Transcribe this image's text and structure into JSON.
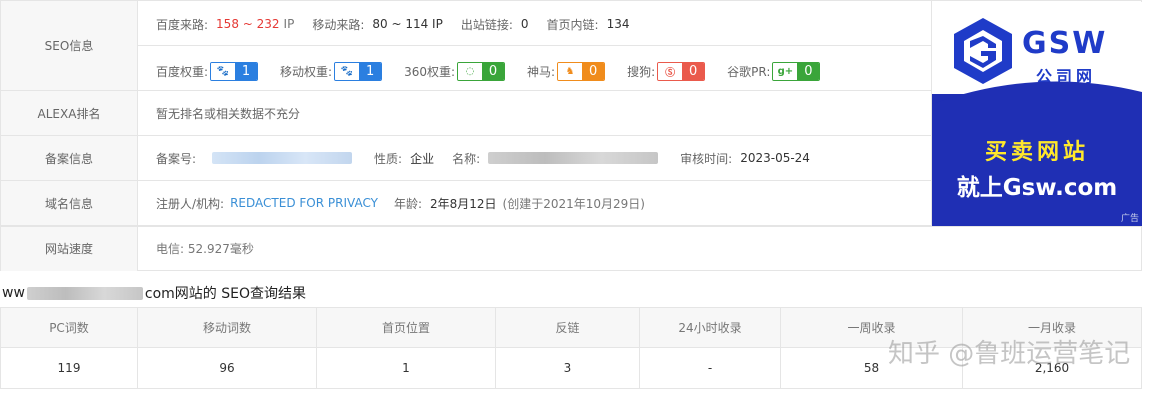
{
  "seo": {
    "label": "SEO信息",
    "line1": {
      "baidu_source_label": "百度来路:",
      "baidu_source_value": "158 ~ 232",
      "baidu_source_unit": "IP",
      "mobile_source_label": "移动来路:",
      "mobile_source_value": "80 ~ 114 IP",
      "outbound_label": "出站链接:",
      "outbound_value": "0",
      "homepage_links_label": "首页内链:",
      "homepage_links_value": "134"
    },
    "line2": {
      "baidu_weight_label": "百度权重:",
      "baidu_weight_value": "1",
      "mobile_weight_label": "移动权重:",
      "mobile_weight_value": "1",
      "w360_label": "360权重:",
      "w360_value": "0",
      "shenma_label": "神马:",
      "shenma_value": "0",
      "sogou_label": "搜狗:",
      "sogou_value": "0",
      "google_label": "谷歌PR:",
      "google_value": "0"
    }
  },
  "alexa": {
    "label": "ALEXA排名",
    "value": "暂无排名或相关数据不充分"
  },
  "icp": {
    "label": "备案信息",
    "number_label": "备案号:",
    "nature_label": "性质:",
    "nature_value": "企业",
    "name_label": "名称:",
    "audit_label": "审核时间:",
    "audit_value": "2023-05-24"
  },
  "domain": {
    "label": "域名信息",
    "registrant_label": "注册人/机构:",
    "registrant_value": "REDACTED FOR PRIVACY",
    "age_label": "年龄:",
    "age_value": "2年8月12日",
    "created_note": "(创建于2021年10月29日)"
  },
  "speed": {
    "label": "网站速度",
    "value": "电信: 52.927毫秒"
  },
  "ad": {
    "brand": "GSW",
    "sub": "公司网",
    "line1": "买卖网站",
    "line2": "就上Gsw.com",
    "tag": "广告"
  },
  "result": {
    "prefix": "ww",
    "suffix": "com网站的 SEO查询结果"
  },
  "stats": {
    "headers": [
      "PC词数",
      "移动词数",
      "首页位置",
      "反链",
      "24小时收录",
      "一周收录",
      "一月收录"
    ],
    "values": [
      "119",
      "96",
      "1",
      "3",
      "-",
      "58",
      "2,160"
    ]
  },
  "watermark": "知乎 @鲁班运营笔记",
  "colors": {
    "red": "#e53935",
    "link": "#3a8fd6",
    "ad_blue": "#1f2fb4",
    "ad_yellow": "#ffe82b"
  },
  "icons": [
    "paw-icon",
    "paw-icon",
    "360-icon",
    "shenma-icon",
    "sogou-icon",
    "google-plus-icon",
    "gsw-logo"
  ]
}
